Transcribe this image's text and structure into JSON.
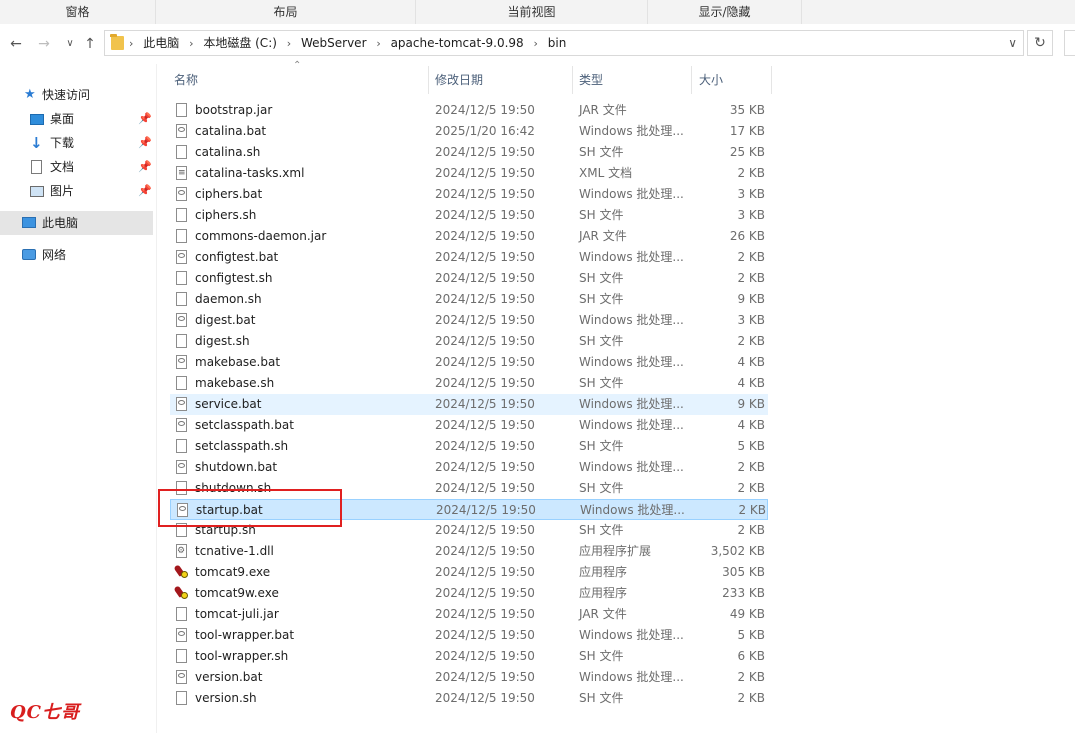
{
  "ribbon": {
    "tabs": [
      "窗格",
      "布局",
      "当前视图",
      "显示/隐藏"
    ]
  },
  "nav": {
    "back_icon": "back-arrow-icon",
    "forward_icon": "forward-arrow-icon",
    "recent_icon": "chevron-down-icon",
    "up_icon": "up-arrow-icon",
    "breadcrumbs": [
      "此电脑",
      "本地磁盘 (C:)",
      "WebServer",
      "apache-tomcat-9.0.98",
      "bin"
    ]
  },
  "sidebar": {
    "quick_access": "快速访问",
    "pinned": [
      "桌面",
      "下载",
      "文档",
      "图片"
    ],
    "this_pc": "此电脑",
    "network": "网络"
  },
  "columns": {
    "name": "名称",
    "date": "修改日期",
    "type": "类型",
    "size": "大小"
  },
  "files": [
    {
      "name": "bootstrap.jar",
      "date": "2024/12/5 19:50",
      "type": "JAR 文件",
      "size": "35 KB",
      "icon": "file"
    },
    {
      "name": "catalina.bat",
      "date": "2025/1/20 16:42",
      "type": "Windows 批处理...",
      "size": "17 KB",
      "icon": "bat"
    },
    {
      "name": "catalina.sh",
      "date": "2024/12/5 19:50",
      "type": "SH 文件",
      "size": "25 KB",
      "icon": "file"
    },
    {
      "name": "catalina-tasks.xml",
      "date": "2024/12/5 19:50",
      "type": "XML 文档",
      "size": "2 KB",
      "icon": "xml"
    },
    {
      "name": "ciphers.bat",
      "date": "2024/12/5 19:50",
      "type": "Windows 批处理...",
      "size": "3 KB",
      "icon": "bat"
    },
    {
      "name": "ciphers.sh",
      "date": "2024/12/5 19:50",
      "type": "SH 文件",
      "size": "3 KB",
      "icon": "file"
    },
    {
      "name": "commons-daemon.jar",
      "date": "2024/12/5 19:50",
      "type": "JAR 文件",
      "size": "26 KB",
      "icon": "file"
    },
    {
      "name": "configtest.bat",
      "date": "2024/12/5 19:50",
      "type": "Windows 批处理...",
      "size": "2 KB",
      "icon": "bat"
    },
    {
      "name": "configtest.sh",
      "date": "2024/12/5 19:50",
      "type": "SH 文件",
      "size": "2 KB",
      "icon": "file"
    },
    {
      "name": "daemon.sh",
      "date": "2024/12/5 19:50",
      "type": "SH 文件",
      "size": "9 KB",
      "icon": "file"
    },
    {
      "name": "digest.bat",
      "date": "2024/12/5 19:50",
      "type": "Windows 批处理...",
      "size": "3 KB",
      "icon": "bat"
    },
    {
      "name": "digest.sh",
      "date": "2024/12/5 19:50",
      "type": "SH 文件",
      "size": "2 KB",
      "icon": "file"
    },
    {
      "name": "makebase.bat",
      "date": "2024/12/5 19:50",
      "type": "Windows 批处理...",
      "size": "4 KB",
      "icon": "bat"
    },
    {
      "name": "makebase.sh",
      "date": "2024/12/5 19:50",
      "type": "SH 文件",
      "size": "4 KB",
      "icon": "file"
    },
    {
      "name": "service.bat",
      "date": "2024/12/5 19:50",
      "type": "Windows 批处理...",
      "size": "9 KB",
      "icon": "bat",
      "state": "hover"
    },
    {
      "name": "setclasspath.bat",
      "date": "2024/12/5 19:50",
      "type": "Windows 批处理...",
      "size": "4 KB",
      "icon": "bat"
    },
    {
      "name": "setclasspath.sh",
      "date": "2024/12/5 19:50",
      "type": "SH 文件",
      "size": "5 KB",
      "icon": "file"
    },
    {
      "name": "shutdown.bat",
      "date": "2024/12/5 19:50",
      "type": "Windows 批处理...",
      "size": "2 KB",
      "icon": "bat"
    },
    {
      "name": "shutdown.sh",
      "date": "2024/12/5 19:50",
      "type": "SH 文件",
      "size": "2 KB",
      "icon": "file"
    },
    {
      "name": "startup.bat",
      "date": "2024/12/5 19:50",
      "type": "Windows 批处理...",
      "size": "2 KB",
      "icon": "bat",
      "state": "selected"
    },
    {
      "name": "startup.sh",
      "date": "2024/12/5 19:50",
      "type": "SH 文件",
      "size": "2 KB",
      "icon": "file"
    },
    {
      "name": "tcnative-1.dll",
      "date": "2024/12/5 19:50",
      "type": "应用程序扩展",
      "size": "3,502 KB",
      "icon": "dll"
    },
    {
      "name": "tomcat9.exe",
      "date": "2024/12/5 19:50",
      "type": "应用程序",
      "size": "305 KB",
      "icon": "exe"
    },
    {
      "name": "tomcat9w.exe",
      "date": "2024/12/5 19:50",
      "type": "应用程序",
      "size": "233 KB",
      "icon": "exe"
    },
    {
      "name": "tomcat-juli.jar",
      "date": "2024/12/5 19:50",
      "type": "JAR 文件",
      "size": "49 KB",
      "icon": "file"
    },
    {
      "name": "tool-wrapper.bat",
      "date": "2024/12/5 19:50",
      "type": "Windows 批处理...",
      "size": "5 KB",
      "icon": "bat"
    },
    {
      "name": "tool-wrapper.sh",
      "date": "2024/12/5 19:50",
      "type": "SH 文件",
      "size": "6 KB",
      "icon": "file"
    },
    {
      "name": "version.bat",
      "date": "2024/12/5 19:50",
      "type": "Windows 批处理...",
      "size": "2 KB",
      "icon": "bat"
    },
    {
      "name": "version.sh",
      "date": "2024/12/5 19:50",
      "type": "SH 文件",
      "size": "2 KB",
      "icon": "file"
    }
  ],
  "highlight_color": "#e02020",
  "watermark": "QC七哥"
}
